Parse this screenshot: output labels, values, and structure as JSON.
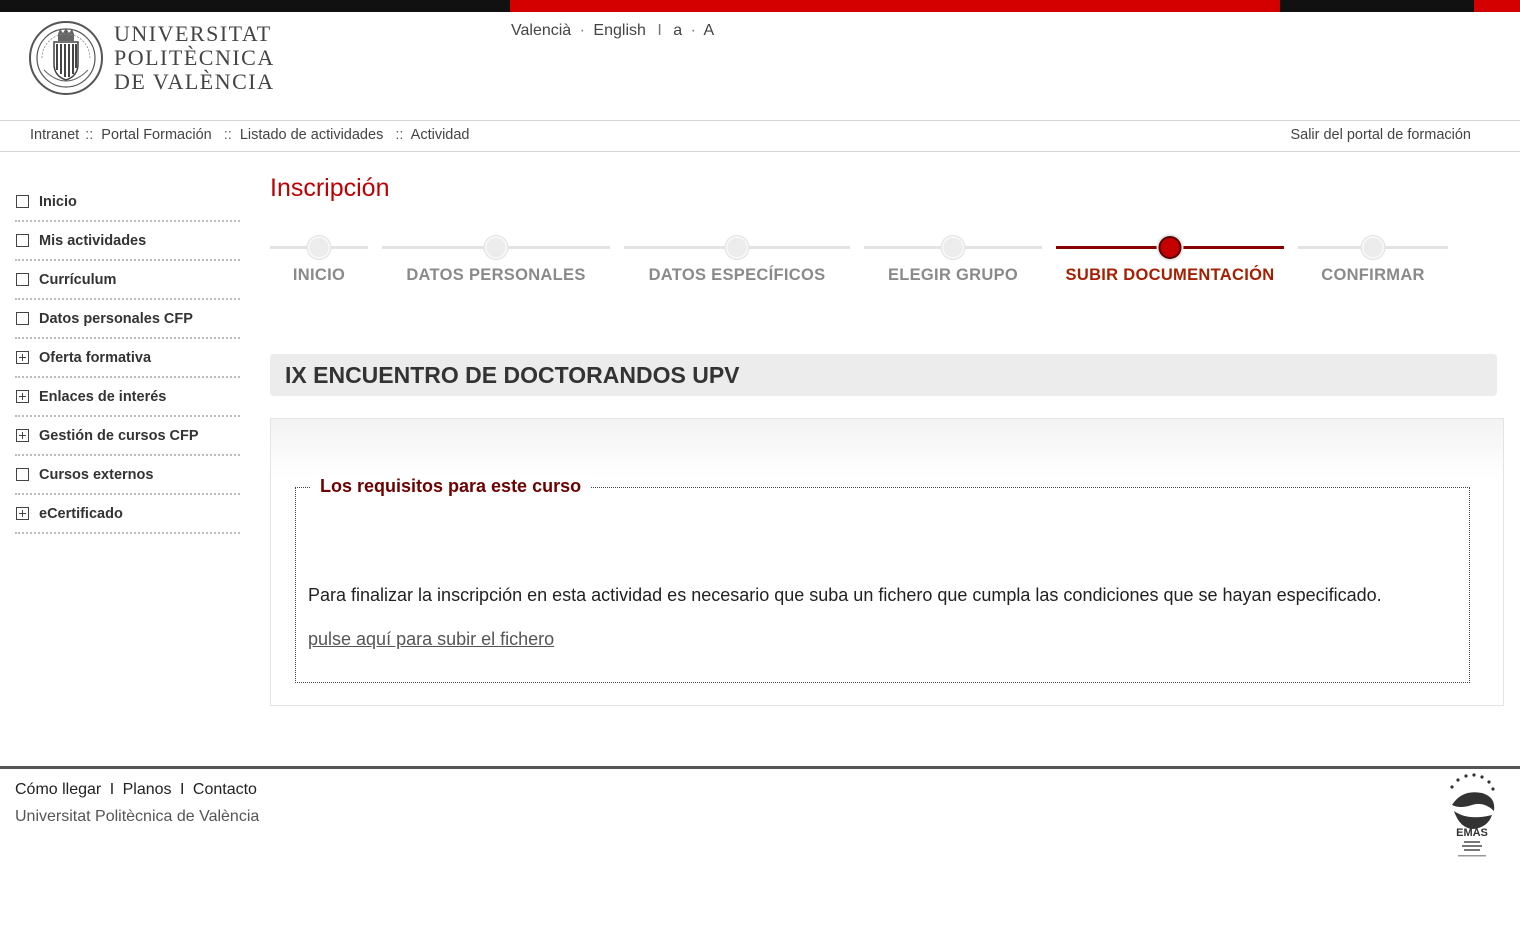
{
  "header": {
    "logo_lines": [
      "UNIVERSITAT",
      "POLITÈCNICA",
      "DE VALÈNCIA"
    ],
    "lang": {
      "valencia": "Valencià",
      "dot1": "·",
      "english": "English",
      "pipe": "I",
      "small_a": "a",
      "dot2": "·",
      "big_a": "A"
    }
  },
  "breadcrumb": {
    "items": [
      "Intranet",
      "Portal Formación",
      "Listado de actividades",
      "Actividad"
    ],
    "separator": "::",
    "logout": "Salir del portal de formación"
  },
  "sidebar": {
    "items": [
      {
        "label": "Inicio",
        "icon": "square-icon"
      },
      {
        "label": "Mis actividades",
        "icon": "square-icon"
      },
      {
        "label": "Currículum",
        "icon": "square-icon"
      },
      {
        "label": "Datos personales CFP",
        "icon": "square-icon"
      },
      {
        "label": "Oferta formativa",
        "icon": "plus-square-icon"
      },
      {
        "label": "Enlaces de interés",
        "icon": "plus-square-icon"
      },
      {
        "label": "Gestión de cursos CFP",
        "icon": "plus-square-icon"
      },
      {
        "label": "Cursos externos",
        "icon": "square-icon"
      },
      {
        "label": "eCertificado",
        "icon": "plus-square-icon"
      }
    ]
  },
  "main": {
    "title": "Inscripción",
    "steps": [
      {
        "label": "INICIO",
        "active": false
      },
      {
        "label": "DATOS PERSONALES",
        "active": false
      },
      {
        "label": "DATOS ESPECÍFICOS",
        "active": false
      },
      {
        "label": "ELEGIR GRUPO",
        "active": false
      },
      {
        "label": "SUBIR DOCUMENTACIÓN",
        "active": true
      },
      {
        "label": "CONFIRMAR",
        "active": false
      }
    ],
    "course_title": "IX ENCUENTRO DE DOCTORANDOS UPV",
    "requirements": {
      "legend": "Los requisitos para este curso",
      "text": "Para finalizar la inscripción en esta actividad es necesario que suba un fichero que cumpla las condiciones que se hayan especificado.",
      "link": "pulse aquí para subir el fichero"
    }
  },
  "footer": {
    "links": [
      "Cómo llegar",
      "Planos",
      "Contacto"
    ],
    "link_separator": "I",
    "university": "Universitat Politècnica de València",
    "emas_label": "EMAS"
  },
  "colors": {
    "brand_red": "#d40000",
    "title_red": "#c00000",
    "active_step": "#a52000",
    "legend_red": "#6e0000"
  }
}
